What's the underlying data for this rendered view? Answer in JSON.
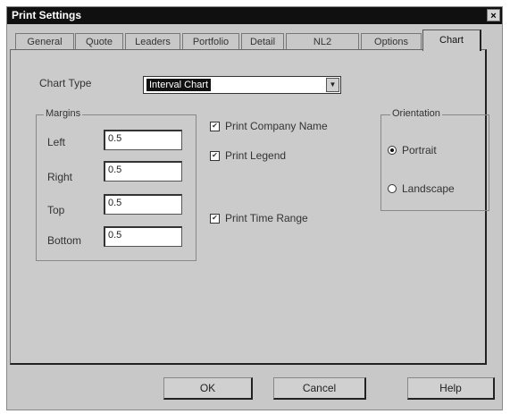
{
  "window": {
    "title": "Print Settings",
    "close_glyph": "×"
  },
  "tabs": [
    {
      "label": "General"
    },
    {
      "label": "Quote"
    },
    {
      "label": "Leaders"
    },
    {
      "label": "Portfolio"
    },
    {
      "label": "Detail"
    },
    {
      "label": "NL2"
    },
    {
      "label": "Options"
    },
    {
      "label": "Chart",
      "active": true
    }
  ],
  "chart_type": {
    "label": "Chart Type",
    "value": "Interval Chart"
  },
  "margins": {
    "legend": "Margins",
    "left": {
      "label": "Left",
      "value": "0.5"
    },
    "right": {
      "label": "Right",
      "value": "0.5"
    },
    "top": {
      "label": "Top",
      "value": "0.5"
    },
    "bottom": {
      "label": "Bottom",
      "value": "0.5"
    }
  },
  "options": {
    "print_company_name": {
      "label": "Print Company Name",
      "checked": true
    },
    "print_legend": {
      "label": "Print Legend",
      "checked": true
    },
    "print_time_range": {
      "label": "Print Time Range",
      "checked": true
    }
  },
  "orientation": {
    "legend": "Orientation",
    "portrait": {
      "label": "Portrait",
      "selected": true
    },
    "landscape": {
      "label": "Landscape",
      "selected": false
    }
  },
  "buttons": {
    "ok": "OK",
    "cancel": "Cancel",
    "help": "Help"
  }
}
